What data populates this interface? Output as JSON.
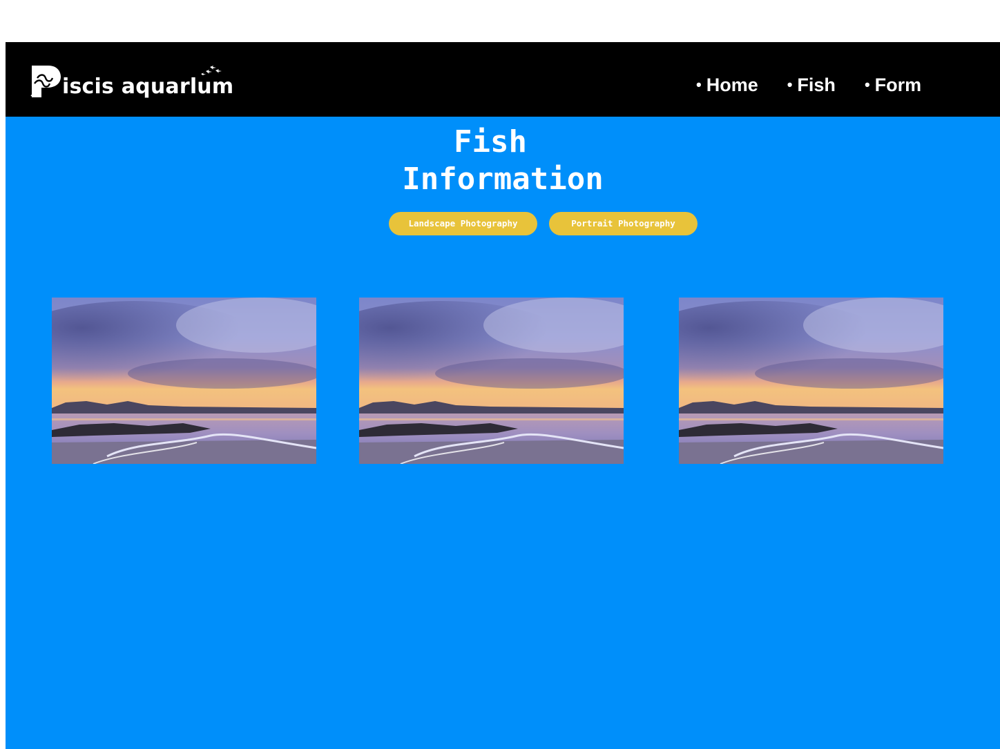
{
  "brand": {
    "logo_initial": "P",
    "name": "iscis aquarlum"
  },
  "nav": {
    "items": [
      {
        "bullet": "•",
        "label": "Home"
      },
      {
        "bullet": "•",
        "label": "Fish"
      },
      {
        "bullet": "•",
        "label": "Form"
      }
    ]
  },
  "hero": {
    "title_line1": "Fish",
    "title_line2": "Information"
  },
  "filters": {
    "landscape_label": "Landscape Photography",
    "portrait_label": "Portrait Photography"
  },
  "gallery": {
    "photos": [
      {
        "subject": "sunset-seascape"
      },
      {
        "subject": "sunset-seascape"
      },
      {
        "subject": "sunset-seascape"
      }
    ]
  },
  "colors": {
    "page_background": "#008ffa",
    "navbar_background": "#000000",
    "pill_background": "#e8c33a",
    "text": "#ffffff"
  }
}
